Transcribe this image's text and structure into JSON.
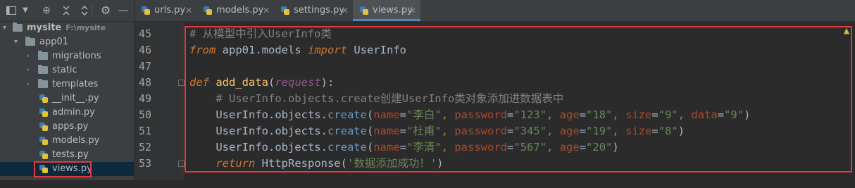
{
  "toolbar": {
    "view_icon": "project-view-icon",
    "add_icon": "crosshair-icon",
    "collapse_icon": "collapse-all-icon",
    "expand_icon": "expand-all-icon",
    "settings_icon": "gear-icon",
    "hide_icon": "minimize-icon"
  },
  "project": {
    "root": {
      "label": "mysite",
      "path": "F:\\mysite"
    },
    "app": {
      "label": "app01"
    },
    "items": [
      {
        "label": "migrations",
        "type": "folder"
      },
      {
        "label": "static",
        "type": "folder"
      },
      {
        "label": "templates",
        "type": "folder"
      },
      {
        "label": "__init__.py",
        "type": "python"
      },
      {
        "label": "admin.py",
        "type": "python"
      },
      {
        "label": "apps.py",
        "type": "python"
      },
      {
        "label": "models.py",
        "type": "python"
      },
      {
        "label": "tests.py",
        "type": "python"
      },
      {
        "label": "views.py",
        "type": "python",
        "selected": true
      }
    ]
  },
  "tabs": [
    {
      "label": "urls.py"
    },
    {
      "label": "models.py"
    },
    {
      "label": "settings.py"
    },
    {
      "label": "views.py",
      "active": true
    }
  ],
  "editor": {
    "line_numbers": [
      "45",
      "46",
      "47",
      "48",
      "49",
      "50",
      "51",
      "52",
      "53"
    ],
    "lines": [
      "# 从模型中引入UserInfo类",
      "from app01.models import UserInfo",
      "",
      "def add_data(request):",
      "    # UserInfo.objects.create创建UserInfo类对象添加进数据表中",
      "    UserInfo.objects.create(name=\"李白\", password=\"123\", age=\"18\", size=\"9\", data=\"9\")",
      "    UserInfo.objects.create(name=\"杜甫\", password=\"345\", age=\"19\", size=\"8\")",
      "    UserInfo.objects.create(name=\"李清\", password=\"567\", age=\"20\")",
      "    return HttpResponse('数据添加成功！')"
    ],
    "warning_icon": "warning-icon"
  },
  "colors": {
    "highlight_border": "#e0393e",
    "keyword": "#cc7832",
    "string": "#6a8759",
    "comment": "#808080",
    "function": "#ffc66d",
    "argument": "#aa4926"
  }
}
